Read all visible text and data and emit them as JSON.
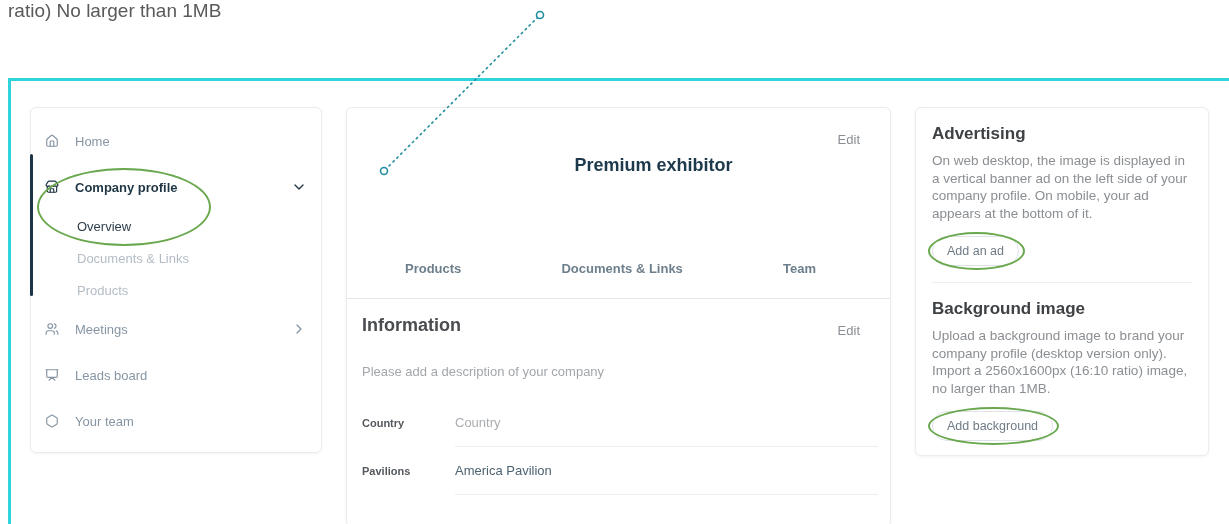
{
  "caption": "ratio) No larger than 1MB",
  "sidebar": {
    "items": [
      {
        "label": "Home",
        "selected": false
      },
      {
        "label": "Company profile",
        "selected": true,
        "expanded": true,
        "highlighted": true,
        "children": [
          {
            "label": "Overview",
            "selected": true
          },
          {
            "label": "Documents & Links",
            "selected": false
          },
          {
            "label": "Products",
            "selected": false
          }
        ]
      },
      {
        "label": "Meetings",
        "selected": false,
        "expanded": false
      },
      {
        "label": "Leads board",
        "selected": false
      },
      {
        "label": "Your team",
        "selected": false
      }
    ]
  },
  "profile": {
    "edit": "Edit",
    "title": "Premium exhibitor",
    "tabs": [
      {
        "label": "Products",
        "selected": false
      },
      {
        "label": "Documents & Links",
        "selected": false
      },
      {
        "label": "Team",
        "selected": false
      }
    ],
    "information": {
      "title": "Information",
      "edit": "Edit",
      "description": "Please add a description of your company",
      "rows": [
        {
          "label": "Country",
          "value": "Country",
          "placeholder": true
        },
        {
          "label": "Pavilions",
          "value": "America Pavilion",
          "placeholder": false
        }
      ]
    }
  },
  "side_panel": [
    {
      "title": "Advertising",
      "text": "On web desktop, the image is displayed in a vertical banner ad on the left side of your company profile. On mobile, your ad appears at the bottom of it.",
      "button": {
        "label": "Add an ad",
        "highlighted": true
      }
    },
    {
      "title": "Background image",
      "text": "Upload a background image to brand your company profile (desktop version only). Import a 2560x1600px (16:10 ratio) image, no larger than 1MB.",
      "button": {
        "label": "Add background",
        "highlighted": true
      }
    }
  ]
}
